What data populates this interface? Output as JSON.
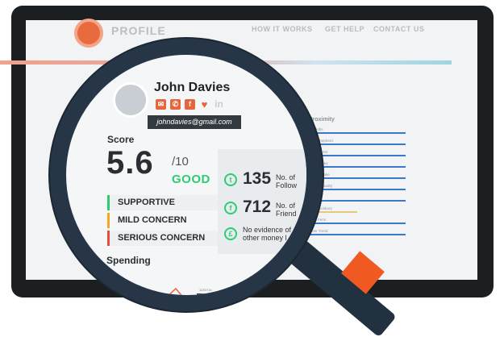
{
  "brand": {
    "logo_text": "PROFILE"
  },
  "nav": {
    "items": [
      "HOW IT WORKS",
      "GET HELP",
      "CONTACT US"
    ]
  },
  "profile": {
    "name": "John Davies",
    "email": "johndavies@gmail.com",
    "contact_icons": [
      "email-icon",
      "phone-icon",
      "facebook-icon",
      "twitter-icon",
      "linkedin-icon"
    ]
  },
  "score": {
    "label": "Score",
    "value": "5.6",
    "out_of": "/10",
    "rating": "GOOD",
    "categories": [
      {
        "label": "SUPPORTIVE",
        "color": "#2ecc71"
      },
      {
        "label": "MILD CONCERN",
        "color": "#f5a623"
      },
      {
        "label": "SERIOUS CONCERN",
        "color": "#e74c3c"
      }
    ]
  },
  "social_stats": [
    {
      "icon": "twitter-icon",
      "value": "135",
      "text": "No. of\nFollow"
    },
    {
      "icon": "facebook-icon",
      "value": "712",
      "text": "No. of\nFriend"
    },
    {
      "icon": "money-icon",
      "value": "",
      "text": "No evidence of\nother money l"
    }
  ],
  "spending": {
    "label": "Spending",
    "chip_value": "2.45"
  },
  "proximity": {
    "title": "Proximity",
    "rows": [
      "Erik Albs",
      "Paul Shepherd",
      "John Carter",
      "Tom Shiney",
      "James Blake",
      "Harold Gaudry",
      "Jan Vrik",
      "Sam Lockbury",
      "John Fenn",
      "Peter Trend"
    ]
  },
  "background_box": {
    "value": "50"
  },
  "colors": {
    "accent": "#e86a3f",
    "good": "#2ecc71",
    "bar": "#3a78c9",
    "lens": "#263646",
    "handle_band": "#f05a22"
  }
}
